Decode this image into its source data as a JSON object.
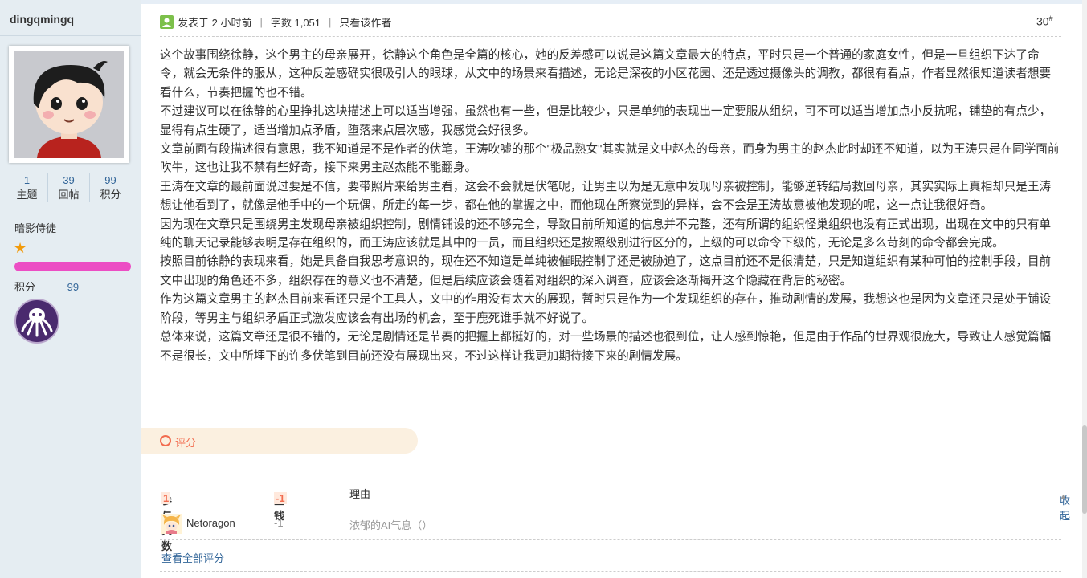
{
  "author": {
    "username": "dingqmingq",
    "stats": [
      {
        "value": "1",
        "label": "主题"
      },
      {
        "value": "39",
        "label": "回帖"
      },
      {
        "value": "99",
        "label": "积分"
      }
    ],
    "group": "暗影侍徒",
    "score_label": "积分",
    "score_value": "99"
  },
  "post": {
    "posted": "发表于 2 小时前",
    "wordcount": "字数 1,051",
    "only_author": "只看该作者",
    "floor": "30",
    "floor_mark": "#",
    "paragraphs": [
      "这个故事围绕徐静，这个男主的母亲展开，徐静这个角色是全篇的核心，她的反差感可以说是这篇文章最大的特点，平时只是一个普通的家庭女性，但是一旦组织下达了命令，就会无条件的服从，这种反差感确实很吸引人的眼球，从文中的场景来看描述，无论是深夜的小区花园、还是透过摄像头的调教，都很有看点，作者显然很知道读者想要看什么，节奏把握的也不错。",
      "不过建议可以在徐静的心里挣扎这块描述上可以适当增强，虽然也有一些，但是比较少，只是单纯的表现出一定要服从组织，可不可以适当增加点小反抗呢，铺垫的有点少，显得有点生硬了，适当增加点矛盾，堕落来点层次感，我感觉会好很多。",
      "文章前面有段描述很有意思，我不知道是不是作者的伏笔，王涛吹嘘的那个\"极品熟女\"其实就是文中赵杰的母亲，而身为男主的赵杰此时却还不知道，以为王涛只是在同学面前吹牛，这也让我不禁有些好奇，接下来男主赵杰能不能翻身。",
      "王涛在文章的最前面说过要是不信，要带照片来给男主看，这会不会就是伏笔呢，让男主以为是无意中发现母亲被控制，能够逆转结局救回母亲，其实实际上真相却只是王涛想让他看到了，就像是他手中的一个玩偶，所走的每一步，都在他的掌握之中，而他现在所察觉到的异样，会不会是王涛故意被他发现的呢，这一点让我很好奇。",
      "因为现在文章只是围绕男主发现母亲被组织控制，剧情铺设的还不够完全，导致目前所知道的信息并不完整，还有所谓的组织怪巢组织也没有正式出现，出现在文中的只有单纯的聊天记录能够表明是存在组织的，而王涛应该就是其中的一员，而且组织还是按照级别进行区分的，上级的可以命令下级的，无论是多么苛刻的命令都会完成。",
      "按照目前徐静的表现来看，她是具备自我思考意识的，现在还不知道是单纯被催眠控制了还是被胁迫了，这点目前还不是很清楚，只是知道组织有某种可怕的控制手段，目前文中出现的角色还不多，组织存在的意义也不清楚，但是后续应该会随着对组织的深入调查，应该会逐渐揭开这个隐藏在背后的秘密。",
      "作为这篇文章男主的赵杰目前来看还只是个工具人，文中的作用没有太大的展现，暂时只是作为一个发现组织的存在，推动剧情的发展，我想这也是因为文章还只是处于铺设阶段，等男主与组织矛盾正式激发应该会有出场的机会，至于鹿死谁手就不好说了。",
      "总体来说，这篇文章还是很不错的，无论是剧情还是节奏的把握上都挺好的，对一些场景的描述也很到位，让人感到惊艳，但是由于作品的世界观很庞大，导致让人感觉篇幅不是很长，文中所埋下的许多伏笔到目前还没有展现出来，不过这样让我更加期待接下来的剧情发展。"
    ]
  },
  "rating": {
    "tab_label": "评分",
    "participants_label": "参与人数",
    "participants_count": "1",
    "coins_label": "金钱",
    "coins_total": "-1",
    "reason_label": "理由",
    "collapse_label": "收起",
    "rows": [
      {
        "user": "Netoragon",
        "coins": "-1",
        "reason": "浓郁的AI气息（）"
      }
    ],
    "view_all": "查看全部评分"
  },
  "colors": {
    "accent": "#f26c4f",
    "link": "#336699",
    "sidebar_bg": "#e5edf2",
    "progress": "#ec4ec4"
  }
}
